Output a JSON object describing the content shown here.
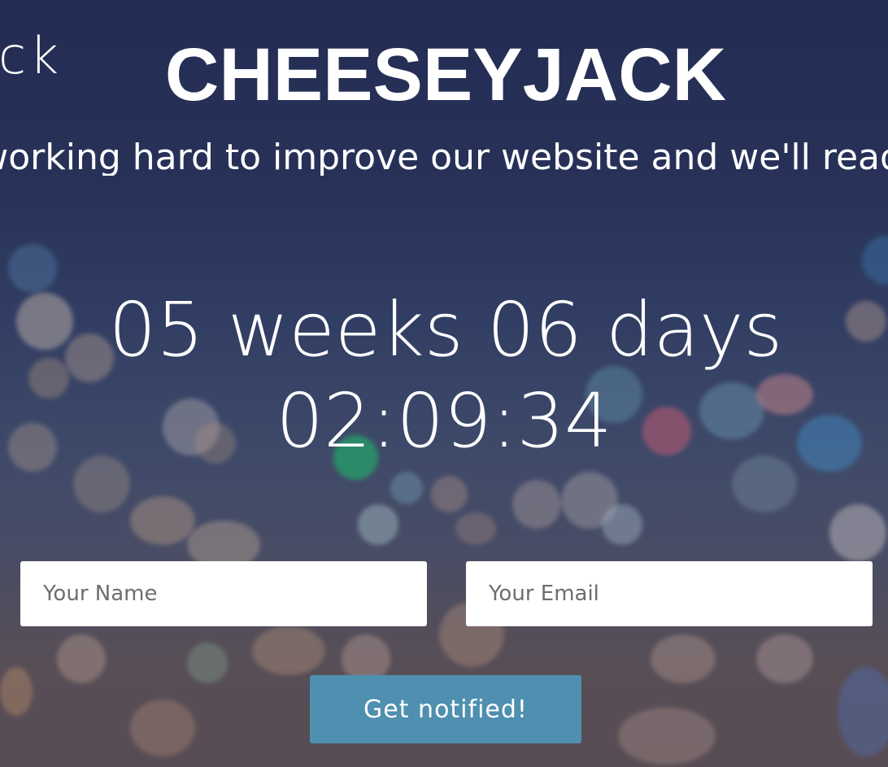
{
  "brand": {
    "logo_partial": "ck",
    "title": "CHEESEYJACK"
  },
  "subtitle": "We're working hard to improve our website and we'll ready to launch after",
  "countdown": {
    "line1": "05 weeks 06 days",
    "line2": "02:09:34"
  },
  "form": {
    "name_placeholder": "Your Name",
    "email_placeholder": "Your Email",
    "submit_label": "Get notified!"
  },
  "colors": {
    "background": "#2a3558",
    "button": "#4f8fb0",
    "text": "#ffffff"
  }
}
